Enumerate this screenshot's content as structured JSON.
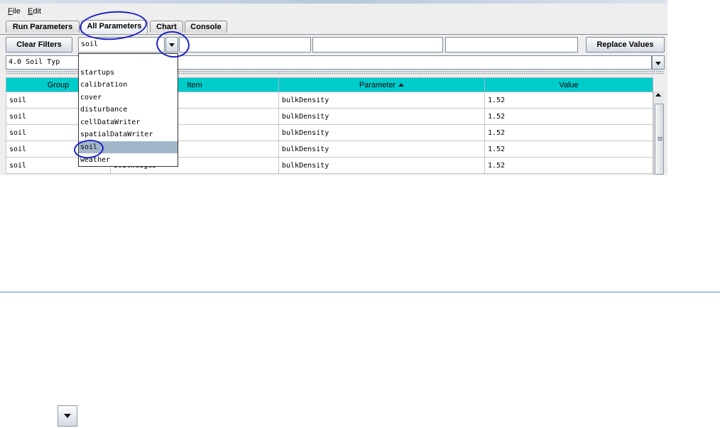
{
  "menu": {
    "file_mn": "F",
    "file_rest": "ile",
    "edit_mn": "E",
    "edit_rest": "dit"
  },
  "tabs": [
    {
      "label": "Run Parameters"
    },
    {
      "label": "All Parameters"
    },
    {
      "label": "Chart"
    },
    {
      "label": "Console"
    }
  ],
  "active_tab": "All Parameters",
  "toolbar": {
    "clear_filters_label": "Clear Filters",
    "group_filter_value": "soil",
    "replace_values_label": "Replace Values"
  },
  "selector": {
    "value": "4.0     Soil Typ"
  },
  "dropdown": {
    "options": [
      "startups",
      "calibration",
      "cover",
      "disturbance",
      "cellDataWriter",
      "spatialDataWriter",
      "soil",
      "weather"
    ],
    "selected": "soil"
  },
  "table": {
    "columns": [
      "Group",
      "Item",
      "Parameter",
      "Value"
    ],
    "sorted_column": "Parameter",
    "sort_direction": "ascending",
    "rows": [
      [
        "soil",
        "",
        "bulkDensity",
        "1.52"
      ],
      [
        "soil",
        "",
        "bulkDensity",
        "1.52"
      ],
      [
        "soil",
        "",
        "bulkDensity",
        "1.52"
      ],
      [
        "soil",
        "",
        "bulkDensity",
        "1.52"
      ],
      [
        "soil",
        "SoilWedges",
        "bulkDensity",
        "1.52"
      ]
    ]
  },
  "colors": {
    "header_bg": "#00cccc",
    "selection": "#a3b6c9",
    "annotation": "#1f22c8",
    "window_bg": "#eeeeee"
  },
  "icons": {
    "dropdown_arrow": "chevron-down-icon",
    "sort": "sort-ascending-icon",
    "scroll_up": "scroll-up-icon"
  }
}
